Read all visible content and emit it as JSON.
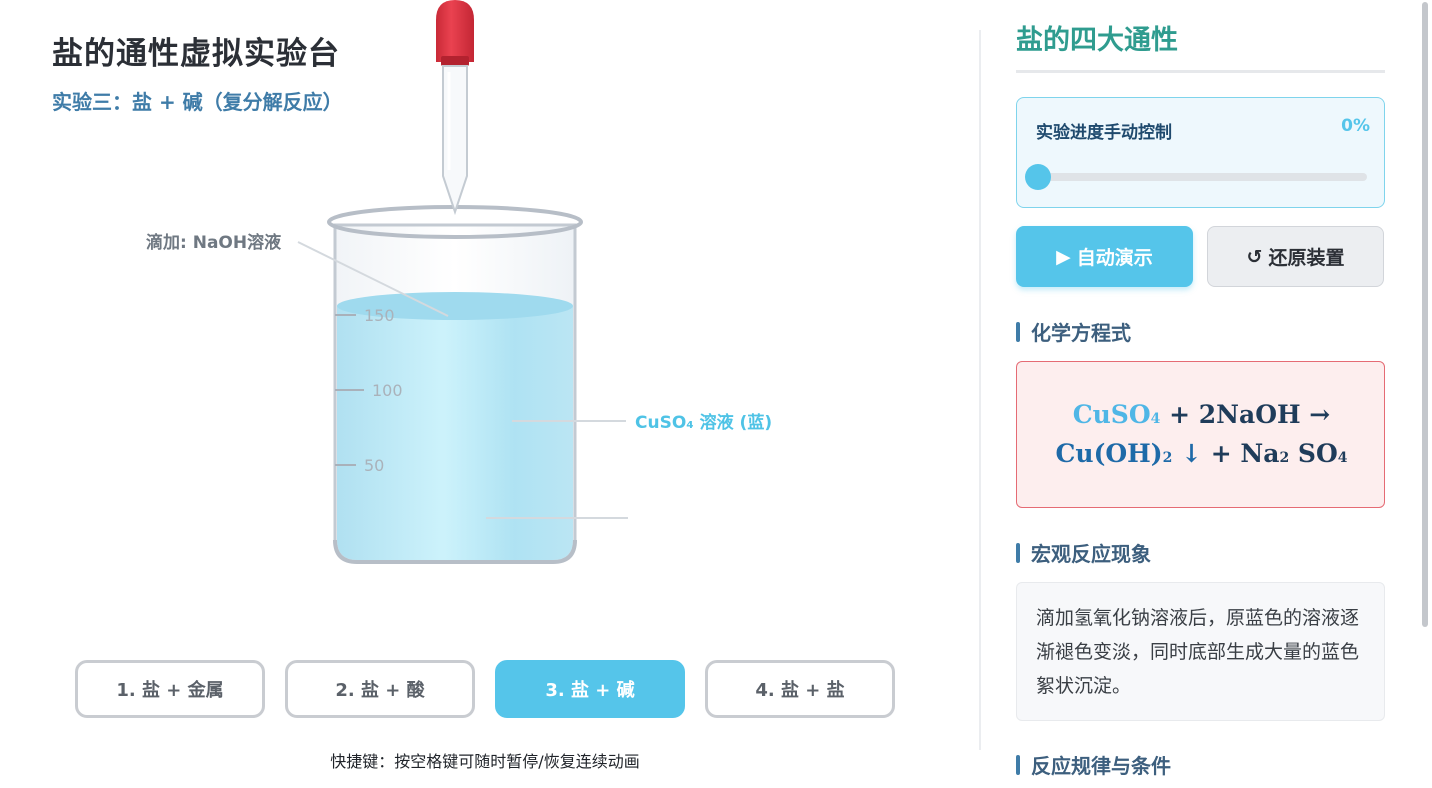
{
  "main": {
    "title": "盐的通性虚拟实验台",
    "subtitle": "实验三：盐 + 碱（复分解反应）",
    "dropper_label": "滴加: NaOH溶液",
    "solution_label": "CuSO₄ 溶液 (蓝)",
    "beaker_marks": [
      "150",
      "100",
      "50"
    ],
    "experiment_buttons": [
      {
        "label": "1. 盐 + 金属",
        "active": false
      },
      {
        "label": "2. 盐 + 酸",
        "active": false
      },
      {
        "label": "3. 盐 + 碱",
        "active": true
      },
      {
        "label": "4. 盐 + 盐",
        "active": false
      }
    ],
    "hint": "快捷键：按空格键可随时暂停/恢复连续动画"
  },
  "sidebar": {
    "title": "盐的四大通性",
    "progress": {
      "label": "实验进度手动控制",
      "value_text": "0%",
      "value": 0
    },
    "auto_button": {
      "icon": "play-icon",
      "glyph": "▶",
      "label": "自动演示"
    },
    "reset_button": {
      "icon": "reset-icon",
      "glyph": "↺",
      "label": "还原装置"
    },
    "equation_heading": "化学方程式",
    "equation": {
      "reactant1": "CuSO",
      "reactant1_sub": "4",
      "plus1": " + 2NaOH →",
      "product1": "Cu(OH)",
      "product1_sub": "2",
      "arrow_down": " ↓",
      "plus2": " + Na",
      "product2_sub1": "2",
      "product2_mid": " SO",
      "product2_sub2": "4"
    },
    "phenomenon_heading": "宏观反应现象",
    "phenomenon_text": "滴加氢氧化钠溶液后，原蓝色的溶液逐渐褪色变淡，同时底部生成大量的蓝色絮状沉淀。",
    "rules_heading": "反应规律与条件"
  },
  "colors": {
    "accent": "#55c5ea",
    "solution": "#8fd8ef",
    "dropper_bulb": "#e13a47",
    "title_teal": "#2f9c8f",
    "equation_border": "#e56b74"
  }
}
